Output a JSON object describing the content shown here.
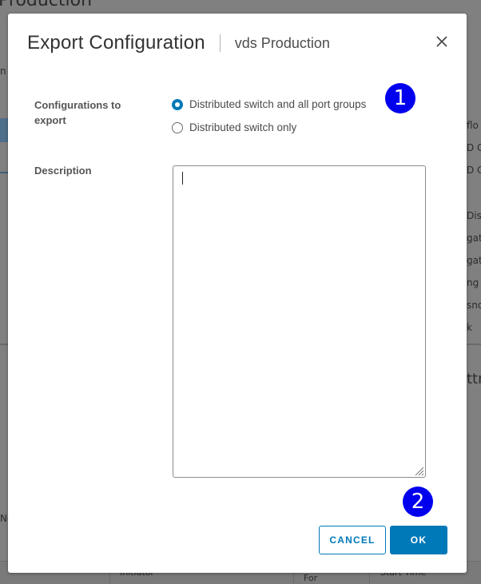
{
  "background": {
    "page_title": "Production",
    "right_fragments": [
      "flo",
      "D C",
      "D C",
      "Disc",
      "gat",
      "gat",
      "ng",
      "sno",
      "k",
      "ttr"
    ],
    "left_fragments": [
      "n",
      "No"
    ],
    "bottom_columns": [
      "Initiator",
      "For",
      "Start Time"
    ]
  },
  "dialog": {
    "title": "Export Configuration",
    "subtitle": "vds Production",
    "close_icon": "close-icon",
    "config_label": "Configurations to export",
    "options": [
      {
        "label": "Distributed switch and all port groups",
        "checked": true
      },
      {
        "label": "Distributed switch only",
        "checked": false
      }
    ],
    "description_label": "Description",
    "description_value": "",
    "cancel_label": "CANCEL",
    "ok_label": "OK"
  },
  "annotations": {
    "badge_1": "1",
    "badge_2": "2"
  },
  "colors": {
    "accent": "#0079b8",
    "badge": "#0000ee",
    "overlay": "#808080"
  }
}
